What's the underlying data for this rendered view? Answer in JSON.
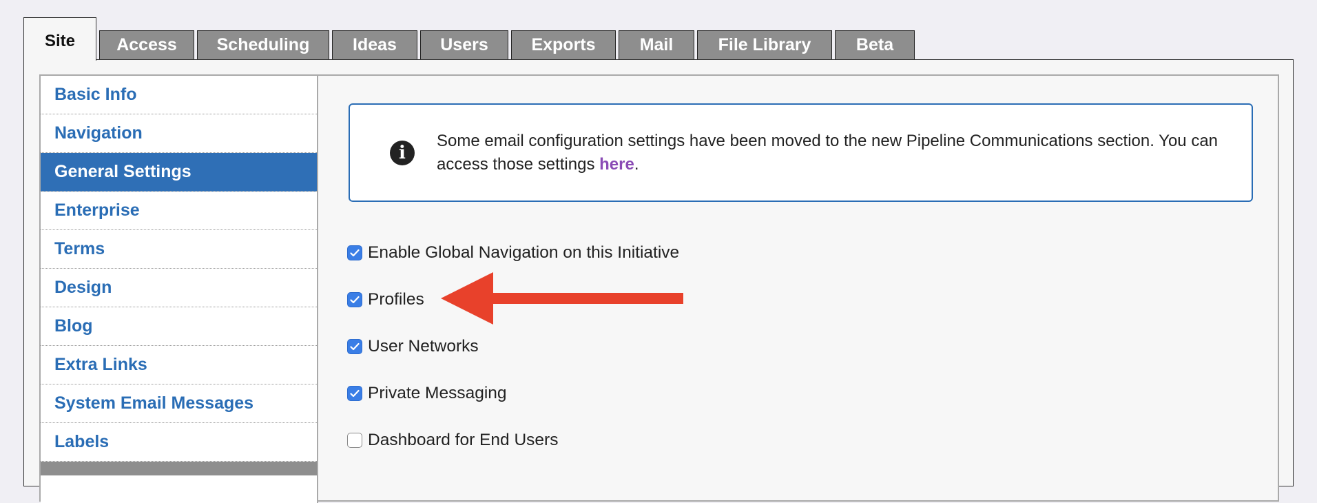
{
  "tabs": [
    {
      "label": "Site",
      "active": true
    },
    {
      "label": "Access"
    },
    {
      "label": "Scheduling"
    },
    {
      "label": "Ideas"
    },
    {
      "label": "Users"
    },
    {
      "label": "Exports"
    },
    {
      "label": "Mail"
    },
    {
      "label": "File Library"
    },
    {
      "label": "Beta"
    }
  ],
  "sidebar": {
    "items": [
      {
        "label": "Basic Info"
      },
      {
        "label": "Navigation"
      },
      {
        "label": "General Settings",
        "active": true
      },
      {
        "label": "Enterprise"
      },
      {
        "label": "Terms"
      },
      {
        "label": "Design"
      },
      {
        "label": "Blog"
      },
      {
        "label": "Extra Links"
      },
      {
        "label": "System Email Messages"
      },
      {
        "label": "Labels"
      }
    ]
  },
  "notice": {
    "icon": "info-icon",
    "text_before": "Some email configuration settings have been moved to the new Pipeline Communications section. You can access those settings ",
    "link_text": "here",
    "text_after": "."
  },
  "options": [
    {
      "label": "Enable Global Navigation on this Initiative",
      "checked": true
    },
    {
      "label": "Profiles",
      "checked": true
    },
    {
      "label": "User Networks",
      "checked": true
    },
    {
      "label": "Private Messaging",
      "checked": true
    },
    {
      "label": "Dashboard for End Users",
      "checked": false
    }
  ],
  "annotation": {
    "icon": "red-arrow-pointing-left",
    "color": "#e8412b"
  },
  "colors": {
    "accent": "#2f6fb6",
    "link": "#2a6db5",
    "visited_link": "#8a4bb5",
    "checkbox": "#3a7ee6",
    "tab_inactive": "#8e8e8e"
  }
}
